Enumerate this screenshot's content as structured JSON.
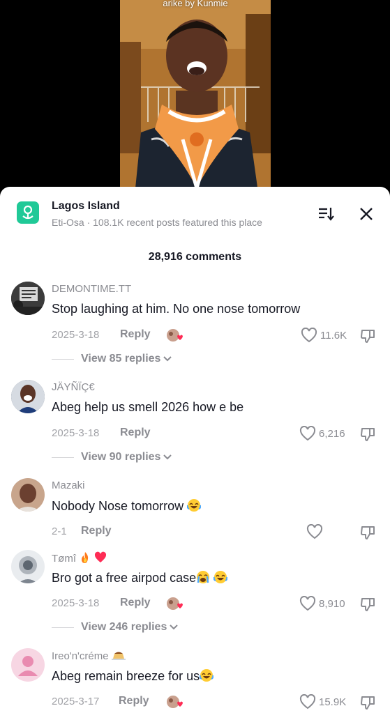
{
  "video": {
    "caption": "arike by Kunmie"
  },
  "place": {
    "title": "Lagos Island",
    "subtitle": "Eti-Osa · 108.1K recent posts featured this place",
    "icon": "location-pin-icon"
  },
  "comments_header": {
    "count_label": "28,916 comments"
  },
  "comments": [
    {
      "username": "DEMONTIME.TT",
      "text": "Stop laughing at him. No one nose tomorrow",
      "date": "2025-3-18",
      "reply": "Reply",
      "likes": "11.6K",
      "view_replies": "View 85 replies"
    },
    {
      "username": "JÄYÑÏÇ€",
      "text": "Abeg help us smell 2026 how e be",
      "date": "2025-3-18",
      "reply": "Reply",
      "likes": "6,216",
      "view_replies": "View 90 replies"
    },
    {
      "username": "Mazaki",
      "text": "Nobody Nose tomorrow",
      "date": "2-1",
      "reply": "Reply",
      "likes": ""
    },
    {
      "username": "Tømî",
      "text": "Bro got a free airpod case",
      "date": "2025-3-18",
      "reply": "Reply",
      "likes": "8,910",
      "view_replies": "View 246 replies"
    },
    {
      "username": "Ireo'n'créme",
      "text": "Abeg remain breeze for us",
      "date": "2025-3-17",
      "reply": "Reply",
      "likes": "15.9K"
    }
  ],
  "colors": {
    "accent": "#20c997",
    "heart": "#fe2c55",
    "muted": "#8a8b91",
    "text": "#161823"
  }
}
